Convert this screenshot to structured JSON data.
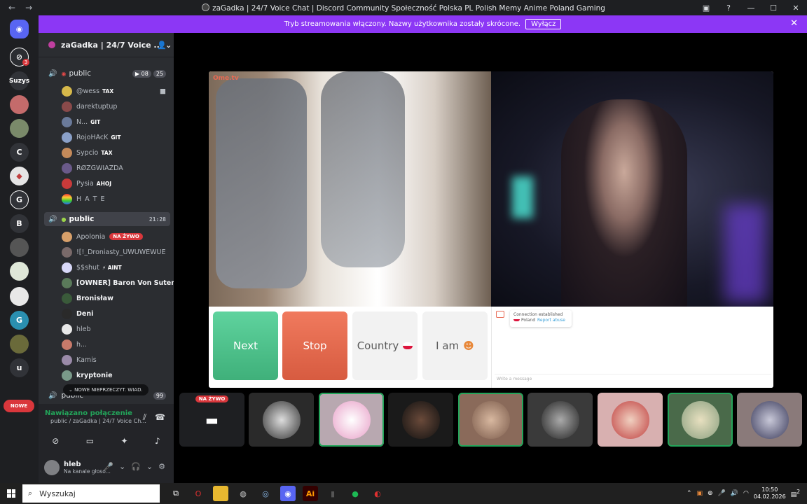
{
  "window": {
    "title": "zaGadka | 24/7 Voice Chat | Discord Community Społeczność Polska PL Polish Memy Anime Poland Gaming"
  },
  "notice": {
    "text": "Tryb streamowania włączony. Nazwy użytkownika zostały skrócone.",
    "button": "Wyłącz"
  },
  "guilds": {
    "badge_count": "3",
    "items": [
      "Suzys",
      "C",
      "B",
      "u"
    ],
    "new_label": "NOWE"
  },
  "server": {
    "name": "zaGadka | 24/7 Voice ..."
  },
  "channels": {
    "first": {
      "name": "public",
      "cam_count": "08",
      "user_count": "25"
    },
    "second": {
      "name": "public",
      "timer": "21:28"
    },
    "third": {
      "name": "public",
      "count": "99"
    }
  },
  "members_a": [
    {
      "name": "@wess",
      "tag": "TAX"
    },
    {
      "name": "darektuptup",
      "tag": ""
    },
    {
      "name": "N...",
      "tag": "GIT"
    },
    {
      "name": "RojoHAcK",
      "tag": "GIT"
    },
    {
      "name": "Sypcio",
      "tag": "TAX"
    },
    {
      "name": "RØZGWIAZDA",
      "tag": ""
    },
    {
      "name": "Pysia",
      "tag": "AHOJ"
    },
    {
      "name": "H A T E",
      "tag": ""
    }
  ],
  "members_b": [
    {
      "name": "Apolonia",
      "live": "NA ŻYWO"
    },
    {
      "name": "![!_Droniasty_UWUWEWUE",
      "live": ""
    },
    {
      "name": "$$shut",
      "live": ""
    },
    {
      "name": "[OWNER] Baron Von Sutenero",
      "live": ""
    },
    {
      "name": "Bronisław",
      "live": ""
    },
    {
      "name": "Deni",
      "live": ""
    },
    {
      "name": "hleb",
      "live": ""
    },
    {
      "name": "h...",
      "live": ""
    },
    {
      "name": "Kamis",
      "live": ""
    },
    {
      "name": "kryptonie",
      "live": ""
    }
  ],
  "unread_pill": "NOWE NIEPRZECZYT. WIAD.",
  "voice": {
    "status": "Nawiązano połączenie",
    "channel": "public / zaGadka | 24/7 Voice Ch..."
  },
  "user": {
    "name": "hleb",
    "status": "Na kanale głoso..."
  },
  "ome": {
    "logo": "Ome.tv",
    "next": "Next",
    "stop": "Stop",
    "country": "Country",
    "iam": "I am",
    "chat_status": "Connection established",
    "chat_country": "Poland",
    "chat_report": "Report abuse",
    "chat_placeholder": "Write a message"
  },
  "strip": {
    "live_label": "NA ŻYWO"
  },
  "taskbar": {
    "search": "Wyszukaj",
    "time": "10:50",
    "date": "04.02.2026",
    "notifications": "2"
  },
  "colors": {
    "accent": "#8c37f5",
    "sidebar": "#2b2d31",
    "guild_bar": "#1e1f22",
    "next": "#4cc48c",
    "stop": "#e06a4e",
    "live": "#da373c",
    "connected": "#23a55a"
  }
}
